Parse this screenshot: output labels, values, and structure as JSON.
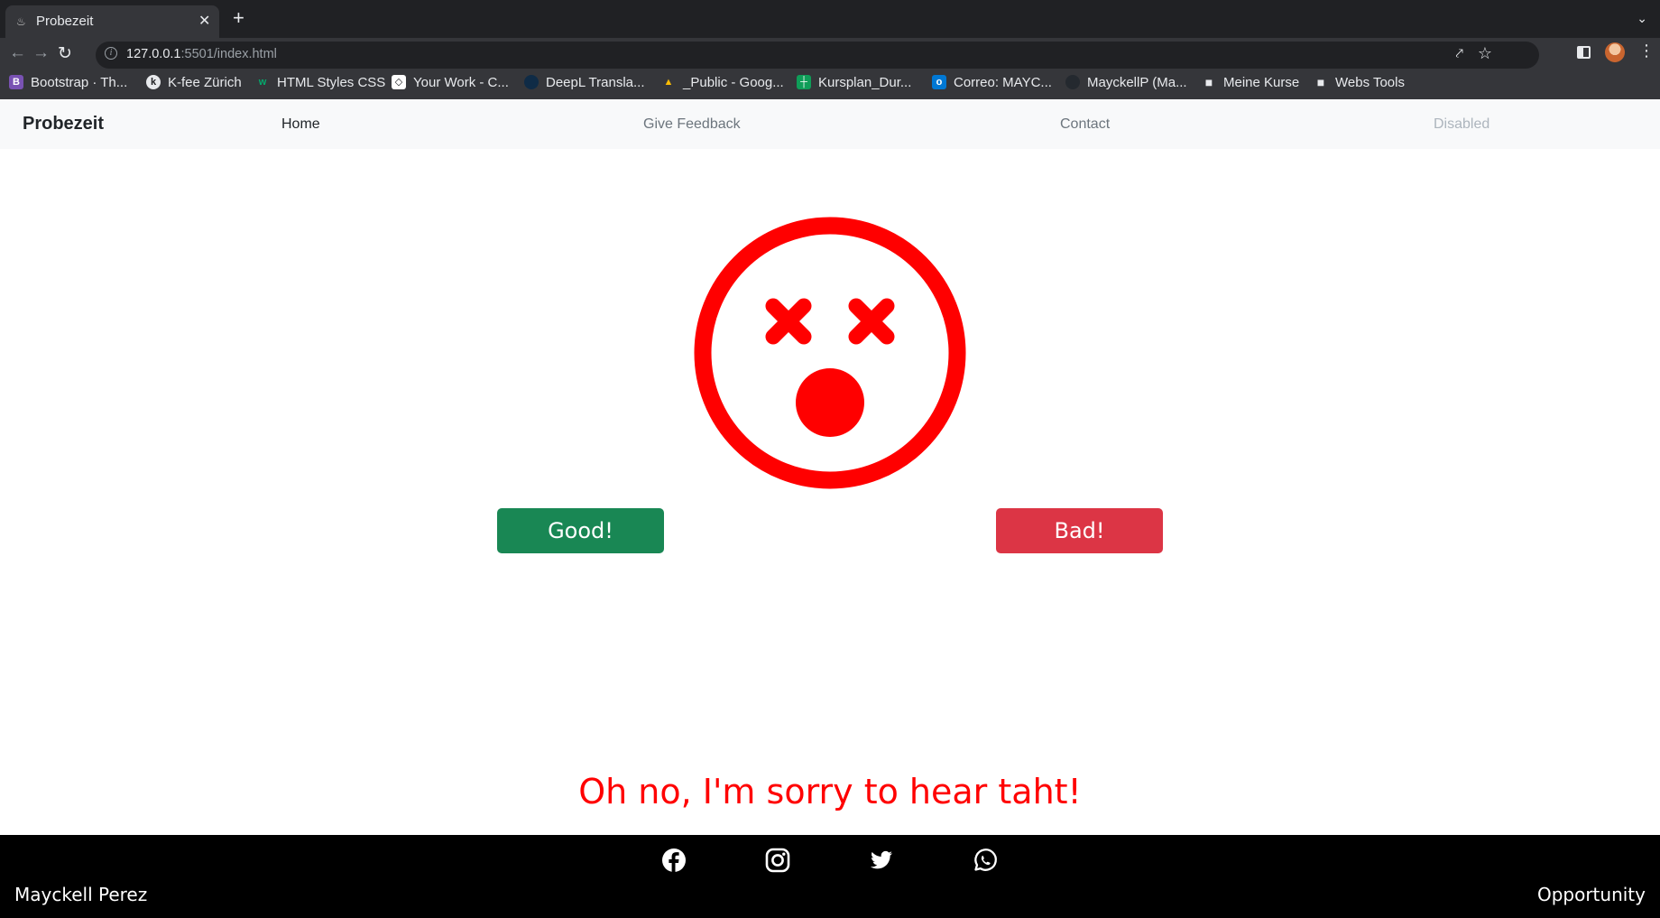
{
  "browser": {
    "tab_title": "Probezeit",
    "new_tab_label": "+",
    "url_host": "127.0.0.1",
    "url_rest": ":5501/index.html",
    "bookmarks": [
      {
        "label": "Bootstrap · Th...",
        "icon": "bootstrap-icon",
        "color": "#7952b3"
      },
      {
        "label": "K-fee Zürich",
        "icon": "k-fee-icon",
        "color": "#e8eaed"
      },
      {
        "label": "HTML Styles CSS",
        "icon": "w3schools-icon",
        "color": "#04aa6d"
      },
      {
        "label": "Your Work - C...",
        "icon": "codecademy-icon",
        "color": "#ffffff"
      },
      {
        "label": "DeepL Transla...",
        "icon": "deepl-icon",
        "color": "#0f2b46"
      },
      {
        "label": "_Public - Goog...",
        "icon": "google-drive-icon",
        "color": "#fbbc04"
      },
      {
        "label": "Kursplan_Dur...",
        "icon": "google-sheets-icon",
        "color": "#0f9d58"
      },
      {
        "label": "Correo: MAYC...",
        "icon": "outlook-icon",
        "color": "#0078d4"
      },
      {
        "label": "MayckellP (Ma...",
        "icon": "github-icon",
        "color": "#24292f"
      },
      {
        "label": "Meine Kurse",
        "icon": "folder-icon",
        "color": "#e8eaed"
      },
      {
        "label": "Webs Tools",
        "icon": "folder-icon",
        "color": "#e8eaed"
      }
    ]
  },
  "navbar": {
    "brand": "Probezeit",
    "links": [
      {
        "label": "Home",
        "state": "active"
      },
      {
        "label": "Give Feedback",
        "state": "normal"
      },
      {
        "label": "Contact",
        "state": "normal"
      },
      {
        "label": "Disabled",
        "state": "disabled"
      }
    ]
  },
  "face": {
    "icon": "dizzy-face-icon",
    "color": "#ff0000"
  },
  "buttons": {
    "good": {
      "label": "Good!",
      "color": "#198754"
    },
    "bad": {
      "label": "Bad!",
      "color": "#dc3545"
    }
  },
  "message": "Oh no, I'm sorry to hear taht!",
  "footer": {
    "social": [
      "facebook-icon",
      "instagram-icon",
      "twitter-icon",
      "whatsapp-icon"
    ],
    "left": "Mayckell Perez",
    "right": "Opportunity"
  }
}
